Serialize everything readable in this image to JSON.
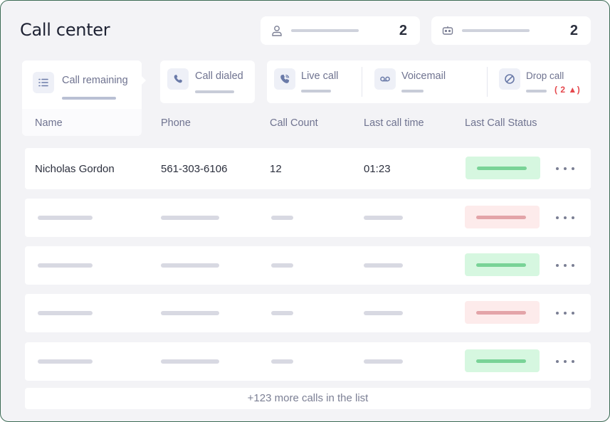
{
  "app": {
    "title": "Call center"
  },
  "stats": [
    {
      "icon": "person-icon",
      "value": "2"
    },
    {
      "icon": "bot-icon",
      "value": "2"
    }
  ],
  "tabs": {
    "remaining": {
      "label": "Call remaining",
      "icon": "list-icon"
    },
    "dialed": {
      "label": "Call dialed",
      "icon": "phone-icon"
    },
    "live": {
      "label": "Live call",
      "icon": "phone-ringing-icon"
    },
    "voicemail": {
      "label": "Voicemail",
      "icon": "voicemail-icon"
    },
    "drop": {
      "label": "Drop call",
      "icon": "block-icon",
      "badge": "( 2 ▲)"
    }
  },
  "table": {
    "headers": [
      "Name",
      "Phone",
      "Call Count",
      "Last call time",
      "Last Call Status"
    ],
    "rows": [
      {
        "name": "Nicholas Gordon",
        "phone": "561-303-6106",
        "count": "12",
        "time": "01:23",
        "status": "ok"
      },
      {
        "status": "bad"
      },
      {
        "status": "ok"
      },
      {
        "status": "bad"
      },
      {
        "status": "ok"
      }
    ]
  },
  "footer": {
    "more_label": "+123 more calls in the list"
  },
  "colors": {
    "accent_border": "#3d6b55",
    "status_ok": "#d6f7e0",
    "status_bad": "#fdebeb",
    "alert": "#e5484d"
  }
}
